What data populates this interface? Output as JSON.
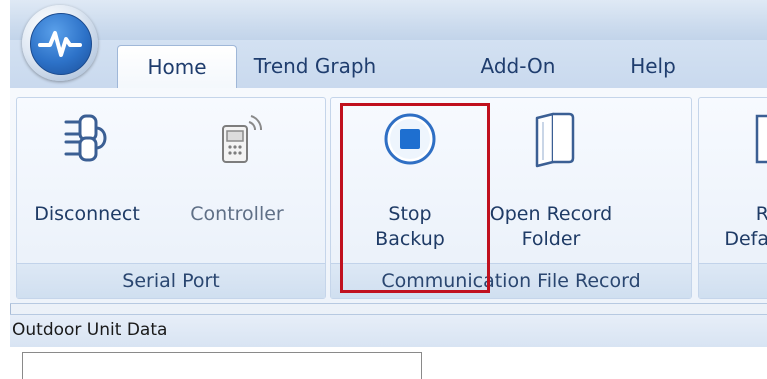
{
  "tabs": [
    {
      "label": "Home",
      "active": true
    },
    {
      "label": "Trend Graph",
      "active": false
    },
    {
      "label": "Add-On",
      "active": false
    },
    {
      "label": "Help",
      "active": false
    }
  ],
  "groups": {
    "serial_port": {
      "label": "Serial Port",
      "buttons": [
        {
          "label": "Disconnect",
          "icon": "plug-connector-icon"
        },
        {
          "label": "Controller",
          "icon": "remote-controller-icon",
          "enabled": false
        }
      ]
    },
    "communication_file_record": {
      "label": "Communication File Record",
      "buttons": [
        {
          "label": "Stop\nBackup",
          "icon": "stop-icon",
          "highlighted": true
        },
        {
          "label": "Open Record\nFolder",
          "icon": "folder-icon"
        }
      ]
    },
    "partial_group": {
      "button_label": "R\nDefa"
    }
  },
  "section": {
    "title": "Outdoor Unit Data"
  },
  "colors": {
    "accent_blue": "#1e6fd0",
    "highlight_red": "#c0101e"
  }
}
